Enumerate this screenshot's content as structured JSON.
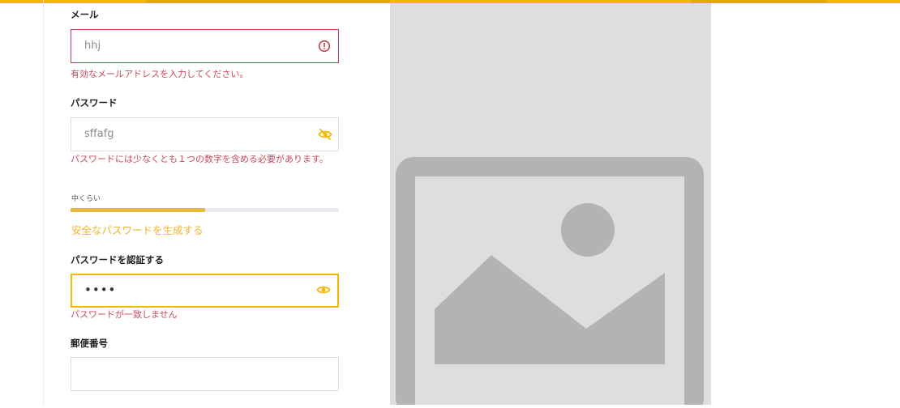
{
  "form": {
    "email": {
      "label": "メール",
      "value": "hhj",
      "error": "有効なメールアドレスを入力してください。"
    },
    "password": {
      "label": "パスワード",
      "value": "sffafg",
      "error": "パスワードには少なくとも１つの数字を含める必要があります。",
      "strength_label": "中くらい",
      "strength_level": 0.5,
      "generate_link": "安全なパスワードを生成する"
    },
    "confirm_password": {
      "label": "パスワードを認証する",
      "value": "••••",
      "error": "パスワードが一致しません"
    },
    "postal_code": {
      "label": "郵便番号",
      "value": ""
    }
  },
  "colors": {
    "accent": "#f4b800",
    "error": "#c83a4f",
    "placeholder_bg": "#dedede",
    "placeholder_fg": "#b3b3b3"
  },
  "icons": {
    "email_status": "error-circle-icon",
    "password_toggle": "eye-off-icon",
    "confirm_toggle": "eye-icon",
    "image": "image-placeholder-icon"
  }
}
